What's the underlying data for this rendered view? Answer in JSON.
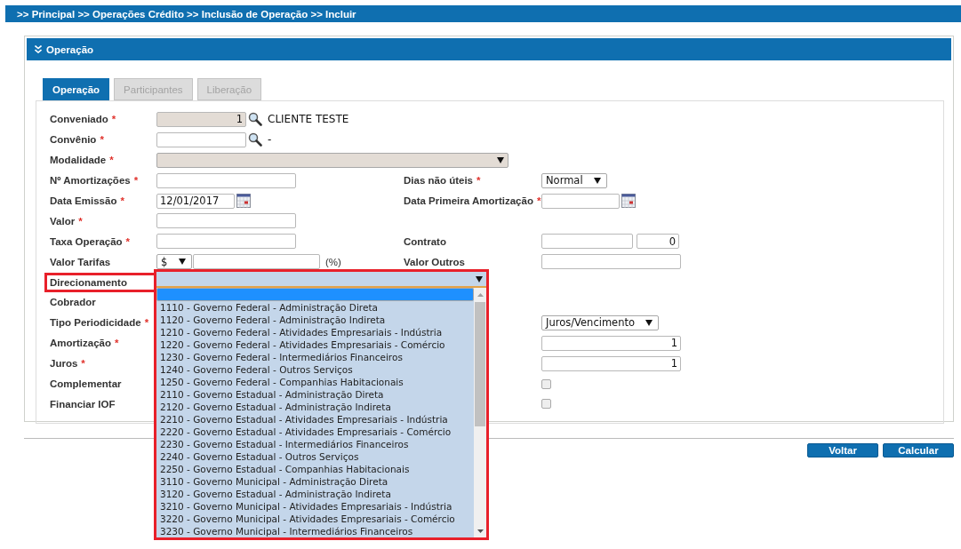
{
  "breadcrumb": ">> Principal >> Operações Crédito >> Inclusão de Operação >> Incluir",
  "panel": {
    "title": "Operação",
    "expanded": true
  },
  "tabs": [
    {
      "label": "Operação",
      "selected": true
    },
    {
      "label": "Participantes",
      "selected": false
    },
    {
      "label": "Liberação",
      "selected": false
    }
  ],
  "rows": [
    {
      "label": "Conveniado",
      "required": "*",
      "highlighted": false,
      "control": {
        "kind": "lookup",
        "value": "1",
        "readonly": true,
        "after": "CLIENTE TESTE"
      }
    },
    {
      "label": "Convênio",
      "required": "*",
      "highlighted": false,
      "control": {
        "kind": "lookup",
        "readonly": false,
        "after": "-"
      }
    },
    {
      "label": "Modalidade",
      "required": "*",
      "highlighted": false,
      "control": {
        "kind": "select",
        "readonly": true
      }
    },
    {
      "label": "Nº Amortizações",
      "required": "*",
      "highlighted": false,
      "control": {
        "kind": "text"
      },
      "right": {
        "label": "Dias não úteis",
        "required": "*",
        "control": {
          "kind": "select",
          "value": "Normal",
          "readonly": false
        }
      }
    },
    {
      "label": "Data Emissão",
      "required": "*",
      "highlighted": false,
      "control": {
        "kind": "date",
        "value": "12/01/2017"
      },
      "right": {
        "label": "Data Primeira Amortização",
        "required": "*",
        "control": {
          "kind": "date"
        }
      }
    },
    {
      "label": "Valor",
      "required": "*",
      "highlighted": false,
      "control": {
        "kind": "text"
      }
    },
    {
      "label": "Taxa Operação",
      "required": "*",
      "highlighted": false,
      "control": {
        "kind": "text"
      },
      "right": {
        "label": "Contrato",
        "control": {
          "kind": "pair",
          "second": "0"
        }
      }
    },
    {
      "label": "Valor Tarifas",
      "highlighted": false,
      "control": {
        "kind": "currency",
        "value": "$",
        "after": "(%)"
      },
      "right": {
        "label": "Valor Outros",
        "control": {
          "kind": "text"
        }
      }
    },
    {
      "label": "Direcionamento",
      "highlighted": true,
      "control": {
        "kind": "dropdown",
        "blank_selected": true,
        "options": [
          {
            "label": "1110 - Governo Federal - Administração Direta",
            "selected": false
          },
          {
            "label": "1120 - Governo Federal - Administração Indireta",
            "selected": false
          },
          {
            "label": "1210 - Governo Federal - Atividades Empresariais - Indústria",
            "selected": false
          },
          {
            "label": "1220 - Governo Federal - Atividades Empresariais - Comércio",
            "selected": false
          },
          {
            "label": "1230 - Governo Federal - Intermediários Financeiros",
            "selected": false
          },
          {
            "label": "1240 - Governo Federal - Outros Serviços",
            "selected": false
          },
          {
            "label": "1250 - Governo Federal - Companhias Habitacionais",
            "selected": false
          },
          {
            "label": "2110 - Governo Estadual - Administração Direta",
            "selected": false
          },
          {
            "label": "2120 - Governo Estadual - Administração Indireta",
            "selected": false
          },
          {
            "label": "2210 - Governo Estadual - Atividades Empresariais - Indústria",
            "selected": false
          },
          {
            "label": "2220 - Governo Estadual - Atividades Empresariais - Comércio",
            "selected": false
          },
          {
            "label": "2230 - Governo Estadual - Intermediários Financeiros",
            "selected": false
          },
          {
            "label": "2240 - Governo Estadual - Outros Serviços",
            "selected": false
          },
          {
            "label": "2250 - Governo Estadual - Companhias Habitacionais",
            "selected": false
          },
          {
            "label": "3110 - Governo Municipal - Administração Direta",
            "selected": false
          },
          {
            "label": "3120 - Governo Estadual - Administração Indireta",
            "selected": false
          },
          {
            "label": "3210 - Governo Municipal - Atividades Empresariais - Indústria",
            "selected": false
          },
          {
            "label": "3220 - Governo Municipal - Atividades Empresariais - Comércio",
            "selected": false
          },
          {
            "label": "3230 - Governo Municipal - Intermediários Financeiros",
            "selected": false
          }
        ]
      }
    },
    {
      "label": "Cobrador",
      "highlighted": false
    },
    {
      "label": "Tipo Periodicidade",
      "required": "*",
      "highlighted": false,
      "right": {
        "control": {
          "kind": "select",
          "value": "Juros/Vencimento",
          "readonly": false
        }
      }
    },
    {
      "label": "Amortização",
      "required": "*",
      "highlighted": false,
      "right": {
        "control": {
          "kind": "text",
          "value": "1"
        }
      }
    },
    {
      "label": "Juros",
      "required": "*",
      "highlighted": false,
      "right": {
        "control": {
          "kind": "text",
          "value": "1"
        }
      }
    },
    {
      "label": "Complementar",
      "highlighted": false,
      "right": {
        "control": {
          "kind": "checkbox",
          "checked": false
        }
      }
    },
    {
      "label": "Financiar IOF",
      "highlighted": false,
      "right": {
        "control": {
          "kind": "checkbox",
          "checked": false
        }
      }
    }
  ],
  "buttons": [
    "Voltar",
    "Calcular"
  ]
}
